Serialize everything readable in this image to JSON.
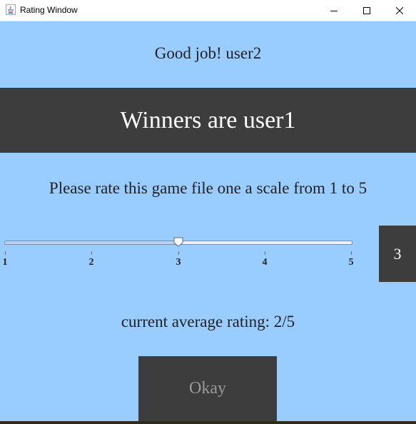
{
  "window": {
    "title": "Rating Window",
    "icon": "java-cup-icon"
  },
  "greeting": "Good job! user2",
  "banner": "Winners are user1",
  "prompt": "Please rate this game file one a scale from 1 to 5",
  "slider": {
    "min": 1,
    "max": 5,
    "value": 3,
    "tick_labels": [
      "1",
      "2",
      "3",
      "4",
      "5"
    ]
  },
  "value_display": "3",
  "average": "current average rating: 2/5",
  "okay_label": "Okay",
  "colors": {
    "background": "#99ccff",
    "panel": "#3d3d3d",
    "banner_text": "#ffffff",
    "button_text": "#9a9a9a"
  }
}
